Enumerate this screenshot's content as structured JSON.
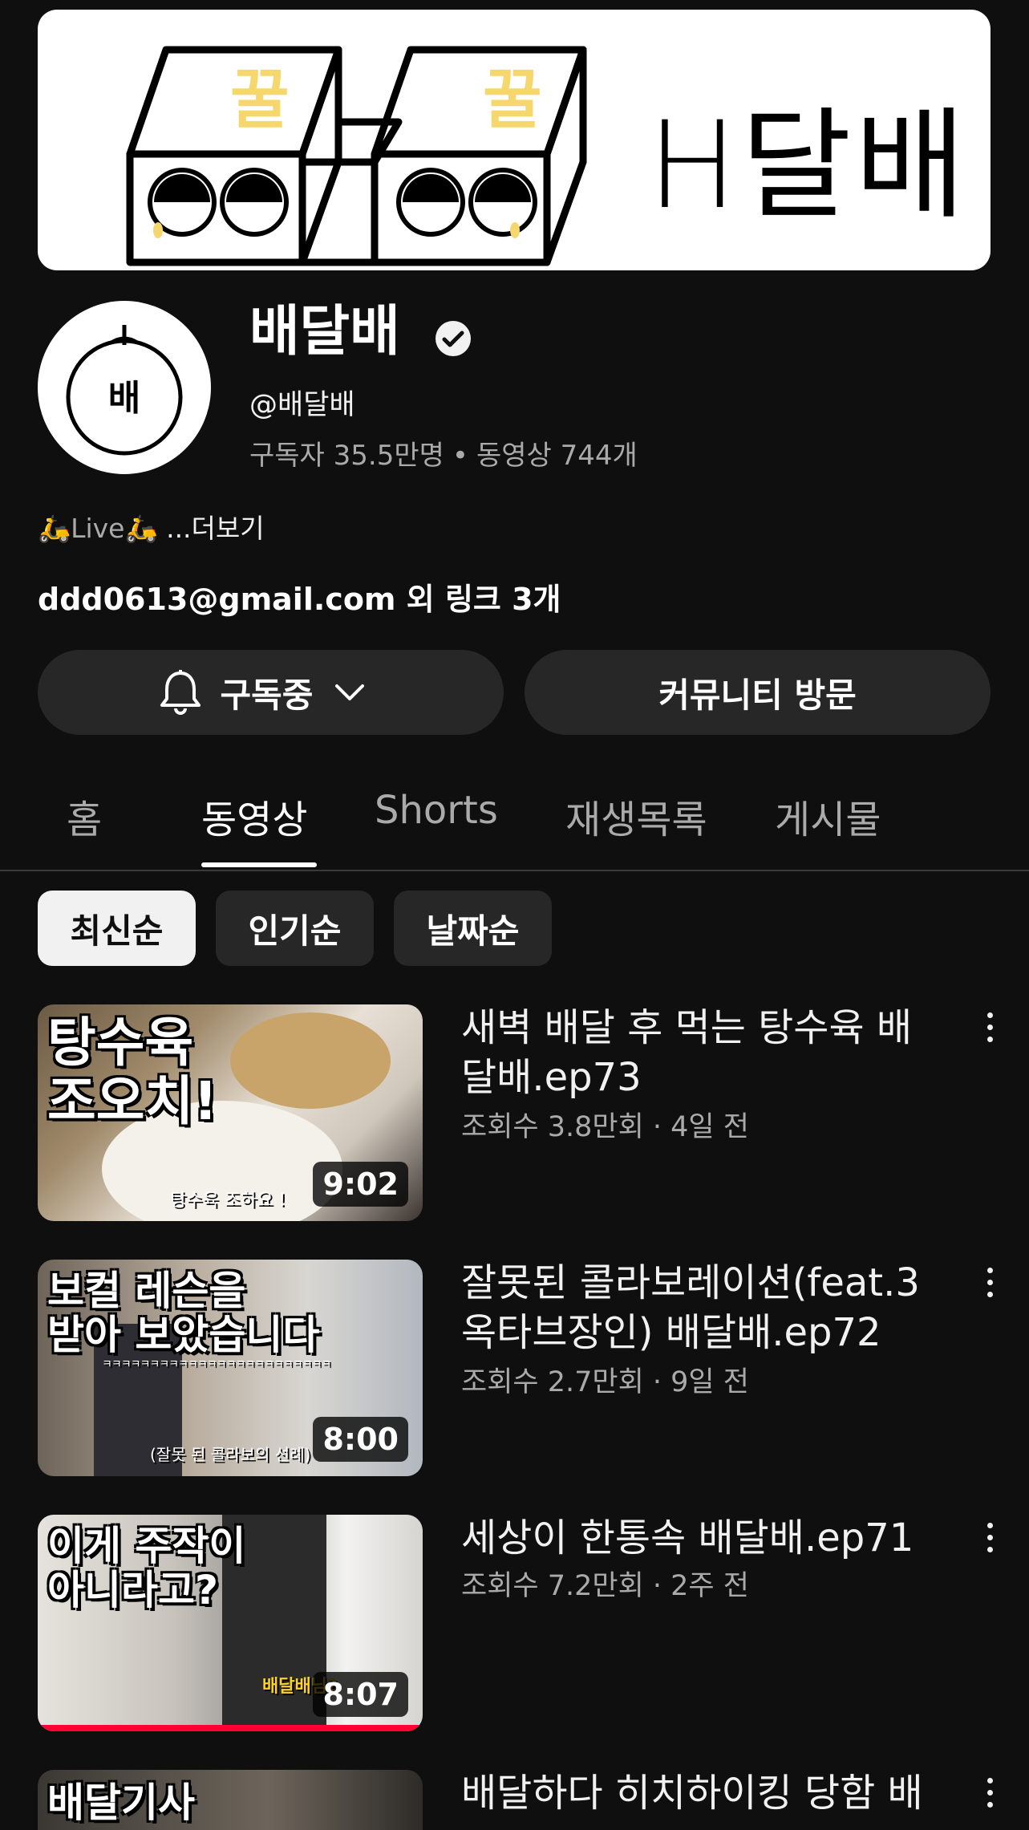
{
  "banner": {
    "honey_label": "꿀",
    "text": "H달배"
  },
  "channel": {
    "avatar_text": "배",
    "name": "배달배",
    "handle": "@배달배",
    "subscribers": "구독자 35.5만명",
    "video_count": "동영상 744개",
    "description": "Live",
    "more": "...더보기",
    "link_email": "ddd0613@gmail.com",
    "link_rest": "외 링크 3개"
  },
  "actions": {
    "subscribe_label": "구독중",
    "community_label": "커뮤니티 방문"
  },
  "tabs": [
    {
      "label": "홈"
    },
    {
      "label": "동영상"
    },
    {
      "label": "Shorts"
    },
    {
      "label": "재생목록"
    },
    {
      "label": "게시물"
    }
  ],
  "chips": [
    {
      "label": "최신순"
    },
    {
      "label": "인기순"
    },
    {
      "label": "날짜순"
    }
  ],
  "videos": [
    {
      "thumb_text_1": "탕수육",
      "thumb_text_2": "조오치!",
      "caption": "탕수육 조하요 !",
      "duration": "9:02",
      "title": "새벽 배달 후 먹는 탕수육 배달배.ep73",
      "meta": "조회수 3.8만회 · 4일 전"
    },
    {
      "thumb_text_1": "보컬 레슨을",
      "thumb_text_2": "받아 보았습니다",
      "caption": "(잘못 된 콜라보의 선례)",
      "caption_top": "ㅋㅋㅋㅋㅋㅋㅋㅋㅋㅋㅋㅋㅋㅋㅋㅋㅋㅋㅋㅋㅋㅋㅋㅋ",
      "duration": "8:00",
      "title": "잘못된 콜라보레이션(feat.3옥타브장인) 배달배.ep72",
      "meta": "조회수 2.7만회 · 9일 전"
    },
    {
      "thumb_text_1": "이게 주작이",
      "thumb_text_2": "아니라고?",
      "caption": "배달배님?",
      "duration": "8:07",
      "watched_fraction": 1.0,
      "title": "세상이 한통속 배달배.ep71",
      "meta": "조회수 7.2만회 · 2주 전"
    },
    {
      "thumb_text_1": "배달기사",
      "title": "배달하다 히치하이킹 당함 배"
    }
  ],
  "colors": {
    "background": "#0f0f0f",
    "button": "#272727",
    "progress": "#ff0033",
    "honey": "#f5d76e"
  }
}
